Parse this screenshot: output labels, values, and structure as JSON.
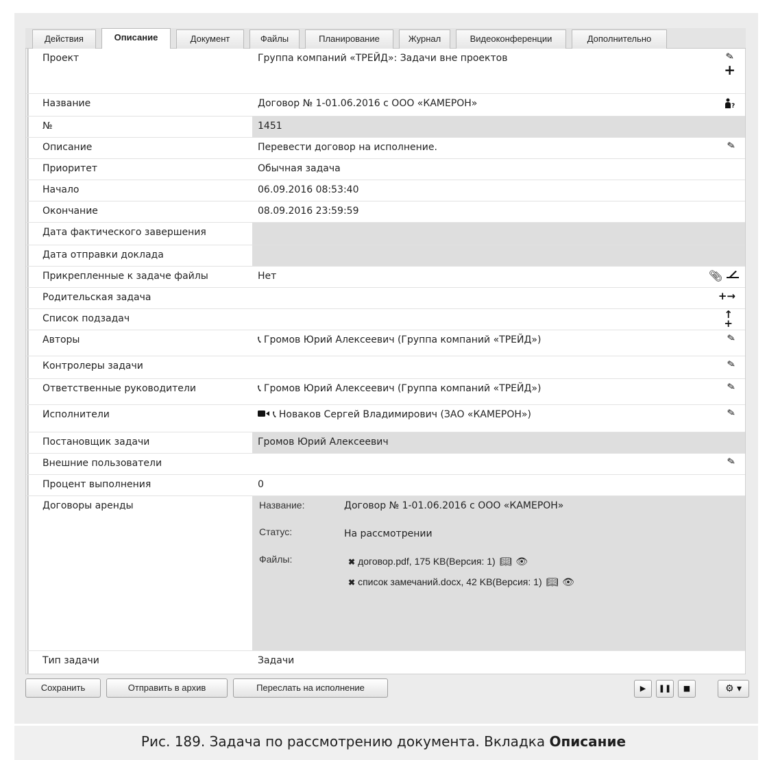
{
  "tabs": [
    "Действия",
    "Описание",
    "Документ",
    "Файлы",
    "Планирование",
    "Журнал",
    "Видеоконференции",
    "Дополнительно"
  ],
  "active_tab": "Описание",
  "fields": [
    {
      "label": "Проект",
      "value": "Группа компаний «ТРЕЙД»: Задачи вне проектов",
      "actions": [
        "pencil-icon",
        "plus-icon"
      ]
    },
    {
      "label": "Название",
      "value": "Договор № 1-01.06.2016 с ООО «КАМЕРОН»",
      "actions": [
        "user-question-icon"
      ]
    },
    {
      "label": "№",
      "value": "1451",
      "value_bg": "grey"
    },
    {
      "label": "Описание",
      "value": "Перевести договор на исполнение.",
      "actions": [
        "pencil-icon"
      ]
    },
    {
      "label": "Приоритет",
      "value": "Обычная задача"
    },
    {
      "label": "Начало",
      "value": "06.09.2016 08:53:40"
    },
    {
      "label": "Окончание",
      "value": "08.09.2016 23:59:59"
    },
    {
      "label": "Дата фактического завершения",
      "value": "",
      "value_bg": "grey"
    },
    {
      "label": "Дата отправки доклада",
      "value": "",
      "value_bg": "grey"
    },
    {
      "label": "Прикрепленные к задаче файлы",
      "value": "Нет",
      "actions": [
        "paperclip-icon",
        "scanner-icon"
      ]
    },
    {
      "label": "Родительская задача",
      "value": "",
      "actions": [
        "link-arrow-icon"
      ]
    },
    {
      "label": "Список подзадач",
      "value": "",
      "actions": [
        "subtask-icon"
      ]
    },
    {
      "label": "Авторы",
      "value": "Громов Юрий Алексеевич (Группа компаний «ТРЕЙД»)",
      "icons": [
        "phone-icon"
      ],
      "actions": [
        "pencil-icon"
      ]
    },
    {
      "label": "Контролеры задачи",
      "value": "",
      "actions": [
        "pencil-icon"
      ]
    },
    {
      "label": "Ответственные руководители",
      "value": "Громов Юрий Алексеевич (Группа компаний «ТРЕЙД»)",
      "icons": [
        "phone-icon"
      ],
      "actions": [
        "pencil-icon"
      ]
    },
    {
      "label": "Исполнители",
      "value": "Новаков Сергей Владимирович (ЗАО «КАМЕРОН»)",
      "icons": [
        "video-icon",
        "phone-icon"
      ],
      "actions": [
        "pencil-icon"
      ]
    },
    {
      "label": "Постановщик задачи",
      "value": "Громов Юрий Алексеевич",
      "value_bg": "grey"
    },
    {
      "label": "Внешние пользователи",
      "value": "",
      "actions": [
        "pencil-icon"
      ]
    },
    {
      "label": "Процент выполнения",
      "value": "0"
    },
    {
      "label": "Договоры аренды",
      "value": "",
      "value_bg": "grey"
    },
    {
      "label": "Тип задачи",
      "value": "Задачи"
    }
  ],
  "lease": {
    "name_label": "Название:",
    "name_value": "Договор № 1-01.06.2016 с ООО «КАМЕРОН»",
    "status_label": "Статус:",
    "status_value": "На рассмотрении",
    "files_label": "Файлы:",
    "files": [
      "договор.pdf, 175 KB(Версия: 1)",
      "список замечаний.docx, 42 KB(Версия: 1)"
    ]
  },
  "buttons": {
    "save": "Сохранить",
    "archive": "Отправить в архив",
    "forward": "Переслать на исполнение"
  },
  "controls": [
    "play-icon",
    "pause-icon",
    "stop-icon",
    "workflow-gear-icon"
  ],
  "caption": {
    "prefix": "Рис. 189. Задача по рассмотрению документа. Вкладка ",
    "bold": "Описание"
  }
}
